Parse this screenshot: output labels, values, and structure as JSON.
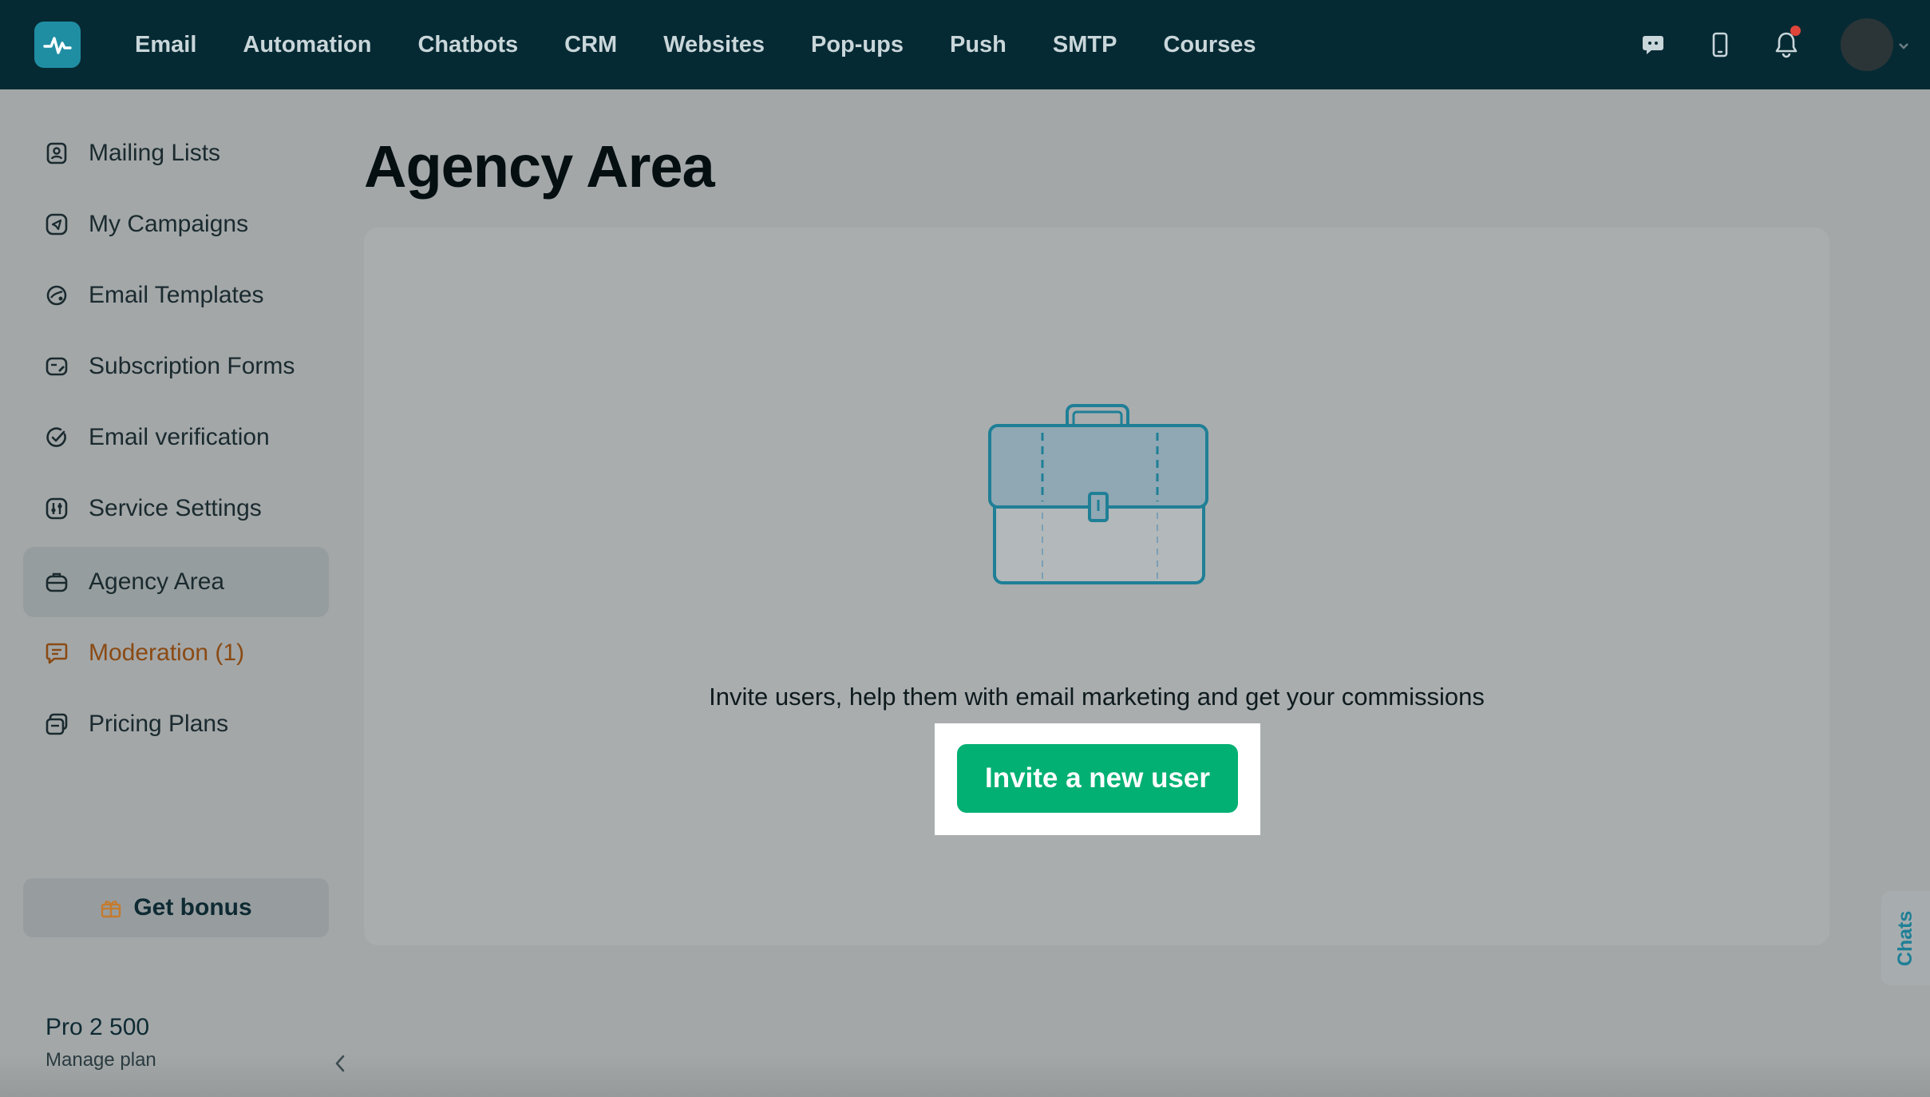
{
  "topnav": {
    "items": [
      "Email",
      "Automation",
      "Chatbots",
      "CRM",
      "Websites",
      "Pop-ups",
      "Push",
      "SMTP",
      "Courses"
    ],
    "icons": [
      "chat-bubble-icon",
      "mobile-phone-icon",
      "bell-icon"
    ],
    "notification_dot_color": "#e0453b"
  },
  "sidebar": {
    "items": [
      {
        "label": "Mailing Lists",
        "icon": "address-book-icon"
      },
      {
        "label": "My Campaigns",
        "icon": "campaigns-icon"
      },
      {
        "label": "Email Templates",
        "icon": "templates-icon"
      },
      {
        "label": "Subscription Forms",
        "icon": "form-icon"
      },
      {
        "label": "Email verification",
        "icon": "check-circle-icon"
      },
      {
        "label": "Service Settings",
        "icon": "settings-sliders-icon"
      },
      {
        "label": "Agency Area",
        "icon": "briefcase-icon",
        "active": true
      },
      {
        "label": "Moderation (1)",
        "icon": "comment-icon"
      },
      {
        "label": "Pricing Plans",
        "icon": "pricing-icon"
      }
    ],
    "bonus_label": "Get bonus",
    "plan_name": "Pro 2 500",
    "manage_plan_label": "Manage plan"
  },
  "main": {
    "title": "Agency Area",
    "description": "Invite users, help them with email marketing and get your commissions",
    "invite_button_label": "Invite a new user"
  },
  "chats_tab_label": "Chats",
  "colors": {
    "topbar": "#062a33",
    "accent_green": "#03b073",
    "logo_teal": "#1f8ea3",
    "moderation_text": "#8a4a14"
  }
}
